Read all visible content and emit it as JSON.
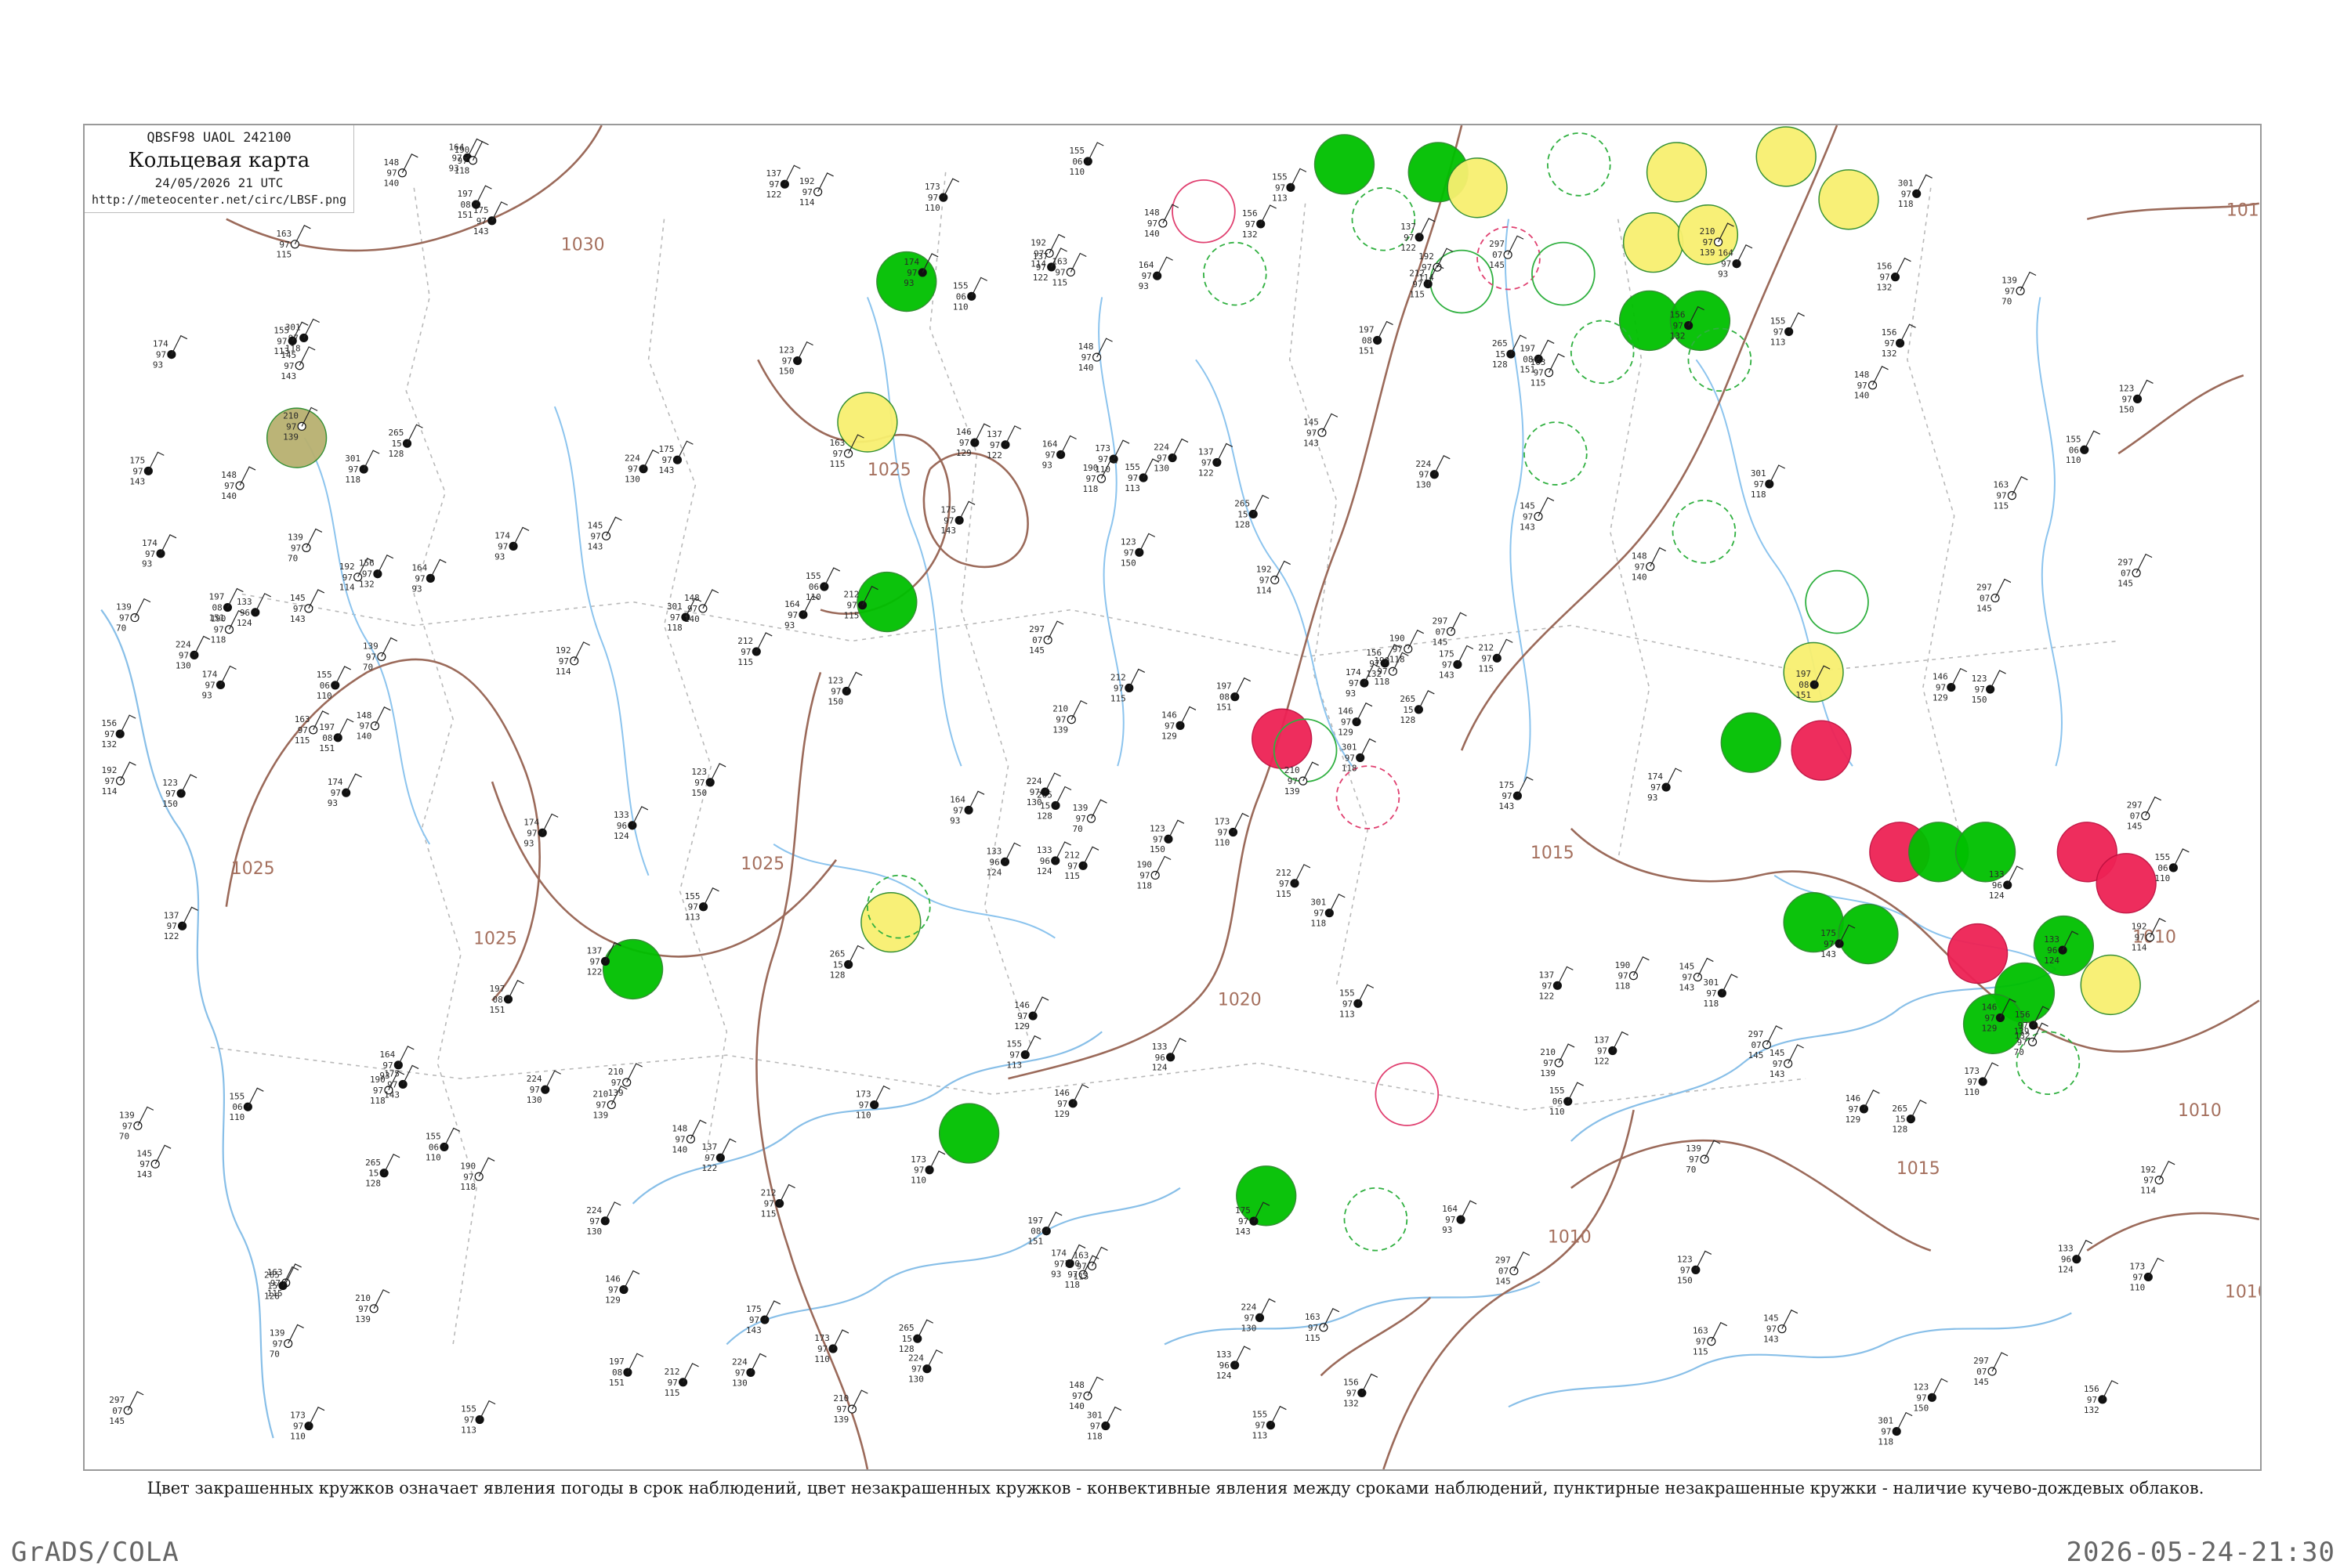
{
  "header": {
    "bulletin_code": "QBSF98  UAOL  242100",
    "title": "Кольцевая карта",
    "datetime": "24/05/2026 21 UTC",
    "url": "http://meteocenter.net/circ/LBSF.png"
  },
  "legend_caption": "Цвет закрашенных кружков означает явления погоды в срок наблюдений, цвет незакрашенных кружков - конвективные явления между сроками наблюдений, пунктирные незакрашенные кружки - наличие кучево-дождевых облаков.",
  "footer": {
    "software": "GrADS/COLA",
    "timestamp": "2026-05-24-21:30"
  },
  "colors": {
    "rain": "#00c000",
    "thunder": "#ee2255",
    "fog": "#f8f070",
    "haze": "#b8b070",
    "isobar": "#9b6a5a",
    "water": "#8cc4ee"
  },
  "isobar_labels": [
    "1030",
    "1025",
    "1025",
    "1025",
    "1025",
    "1020",
    "1015",
    "1015",
    "1010",
    "1010",
    "1010",
    "1010",
    "1010"
  ],
  "stations": [
    {
      "p": "190",
      "t": "97",
      "v": "118"
    },
    {
      "p": "301",
      "t": "97",
      "v": "118"
    },
    {
      "p": "265",
      "t": "15",
      "v": "128"
    },
    {
      "p": "163",
      "t": "97",
      "v": "115"
    },
    {
      "p": "174",
      "t": "97",
      "v": "93"
    },
    {
      "p": "137",
      "t": "97",
      "v": "122"
    },
    {
      "p": "297",
      "t": "07",
      "v": "145"
    },
    {
      "p": "224",
      "t": "97",
      "v": "130"
    },
    {
      "p": "197",
      "t": "08",
      "v": "151"
    },
    {
      "p": "210",
      "t": "97",
      "v": "139"
    },
    {
      "p": "175",
      "t": "97",
      "v": "143"
    },
    {
      "p": "156",
      "t": "97",
      "v": "132"
    },
    {
      "p": "148",
      "t": "97",
      "v": "140"
    },
    {
      "p": "123",
      "t": "97",
      "v": "150"
    },
    {
      "p": "133",
      "t": "96",
      "v": "124"
    },
    {
      "p": "145",
      "t": "97",
      "v": "143"
    },
    {
      "p": "155",
      "t": "97",
      "v": "113"
    },
    {
      "p": "164",
      "t": "97",
      "v": "93"
    },
    {
      "p": "192",
      "t": "97",
      "v": "114"
    },
    {
      "p": "155",
      "t": "06",
      "v": "110"
    },
    {
      "p": "212",
      "t": "97",
      "v": "115"
    },
    {
      "p": "139",
      "t": "97",
      "v": "70"
    },
    {
      "p": "146",
      "t": "97",
      "v": "129"
    },
    {
      "p": "173",
      "t": "97",
      "v": "110"
    }
  ]
}
